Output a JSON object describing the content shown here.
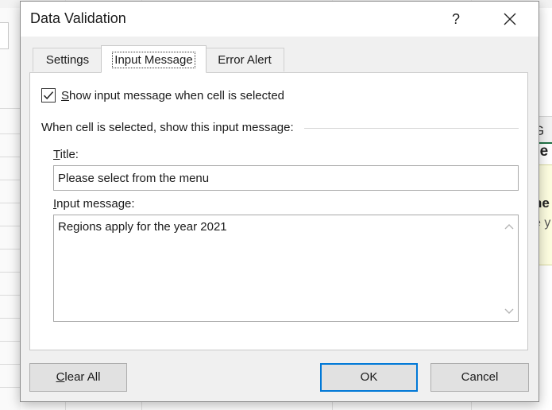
{
  "dialog": {
    "title": "Data Validation",
    "help_label": "?",
    "tabs": [
      {
        "label": "Settings",
        "active": false
      },
      {
        "label": "Input Message",
        "active": true
      },
      {
        "label": "Error Alert",
        "active": false
      }
    ],
    "show_message": {
      "checked": true,
      "mnemonic": "S",
      "label_rest": "how input message when cell is selected"
    },
    "group_label": "When cell is selected, show this input message:",
    "title_field": {
      "mnemonic": "T",
      "label_rest": "itle:",
      "value": "Please select from the menu"
    },
    "message_field": {
      "mnemonic": "I",
      "label_rest": "nput message:",
      "value": "Regions apply for the year 2021"
    },
    "buttons": {
      "clear_mnemonic": "C",
      "clear_rest": "lear All",
      "ok": "OK",
      "cancel": "Cancel"
    }
  },
  "background": {
    "column_header": "G",
    "cell_fragment": "ge",
    "comment_line1": "he",
    "comment_line2": "e y"
  },
  "colors": {
    "accent": "#0078d7",
    "excel_green": "#217346",
    "dialog_bg": "#f0f0f0"
  }
}
